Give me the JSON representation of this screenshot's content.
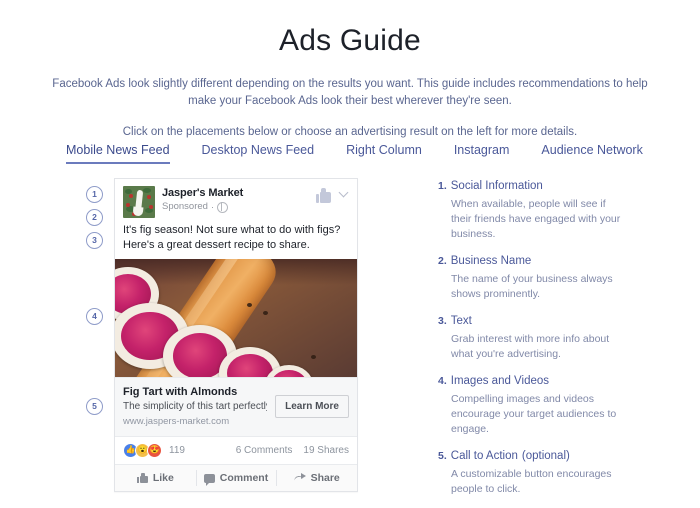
{
  "header": {
    "title": "Ads Guide",
    "intro_1": "Facebook Ads look slightly different depending on the results you want. This guide includes recommendations to help make your Facebook Ads look their best wherever they're seen.",
    "intro_2": "Click on the placements below or choose an advertising result on the left for more details."
  },
  "tabs": [
    {
      "label": "Mobile News Feed",
      "active": true
    },
    {
      "label": "Desktop News Feed",
      "active": false
    },
    {
      "label": "Right Column",
      "active": false
    },
    {
      "label": "Instagram",
      "active": false
    },
    {
      "label": "Audience Network",
      "active": false
    }
  ],
  "callouts": [
    "1",
    "2",
    "3",
    "4",
    "5"
  ],
  "ad": {
    "page_name": "Jasper's Market",
    "sponsored": "Sponsored",
    "separator": "·",
    "globe_icon": "globe-icon",
    "thumb_icon": "thumbs-up-icon",
    "chevron_icon": "chevron-down-icon",
    "body_text": "It's fig season! Not sure what to do with figs? Here's a great dessert recipe to share.",
    "photo_alt": "fig-tart-photo",
    "link_title": "Fig Tart with Almonds",
    "link_desc": "The simplicity of this tart perfectly ...",
    "link_url": "www.jaspers-market.com",
    "cta_label": "Learn More",
    "reactions": {
      "icons": [
        "like-reaction-icon",
        "wow-reaction-icon",
        "love-reaction-icon"
      ],
      "count": "119"
    },
    "comments": "6 Comments",
    "shares": "19 Shares",
    "actions": [
      {
        "label": "Like",
        "icon": "thumbs-up-icon"
      },
      {
        "label": "Comment",
        "icon": "speech-bubble-icon"
      },
      {
        "label": "Share",
        "icon": "share-arrow-icon"
      }
    ]
  },
  "descriptions": [
    {
      "num": "1.",
      "title": "Social Information",
      "optional": "",
      "text": "When available, people will see if their friends have engaged with your business."
    },
    {
      "num": "2.",
      "title": "Business Name",
      "optional": "",
      "text": "The name of your business always shows prominently."
    },
    {
      "num": "3.",
      "title": "Text",
      "optional": "",
      "text": "Grab interest with more info about what you're advertising."
    },
    {
      "num": "4.",
      "title": "Images and Videos",
      "optional": "",
      "text": "Compelling images and videos encourage your target audiences to engage."
    },
    {
      "num": "5.",
      "title": "Call to Action",
      "optional": "(optional)",
      "text": "A customizable button encourages people to click."
    }
  ],
  "colors": {
    "accent": "#4a5899",
    "title": "#1d2129",
    "muted": "#8189a8",
    "reaction_like": "#4a80e8",
    "reaction_wow": "#f3bf4b",
    "reaction_love": "#e9533f"
  }
}
